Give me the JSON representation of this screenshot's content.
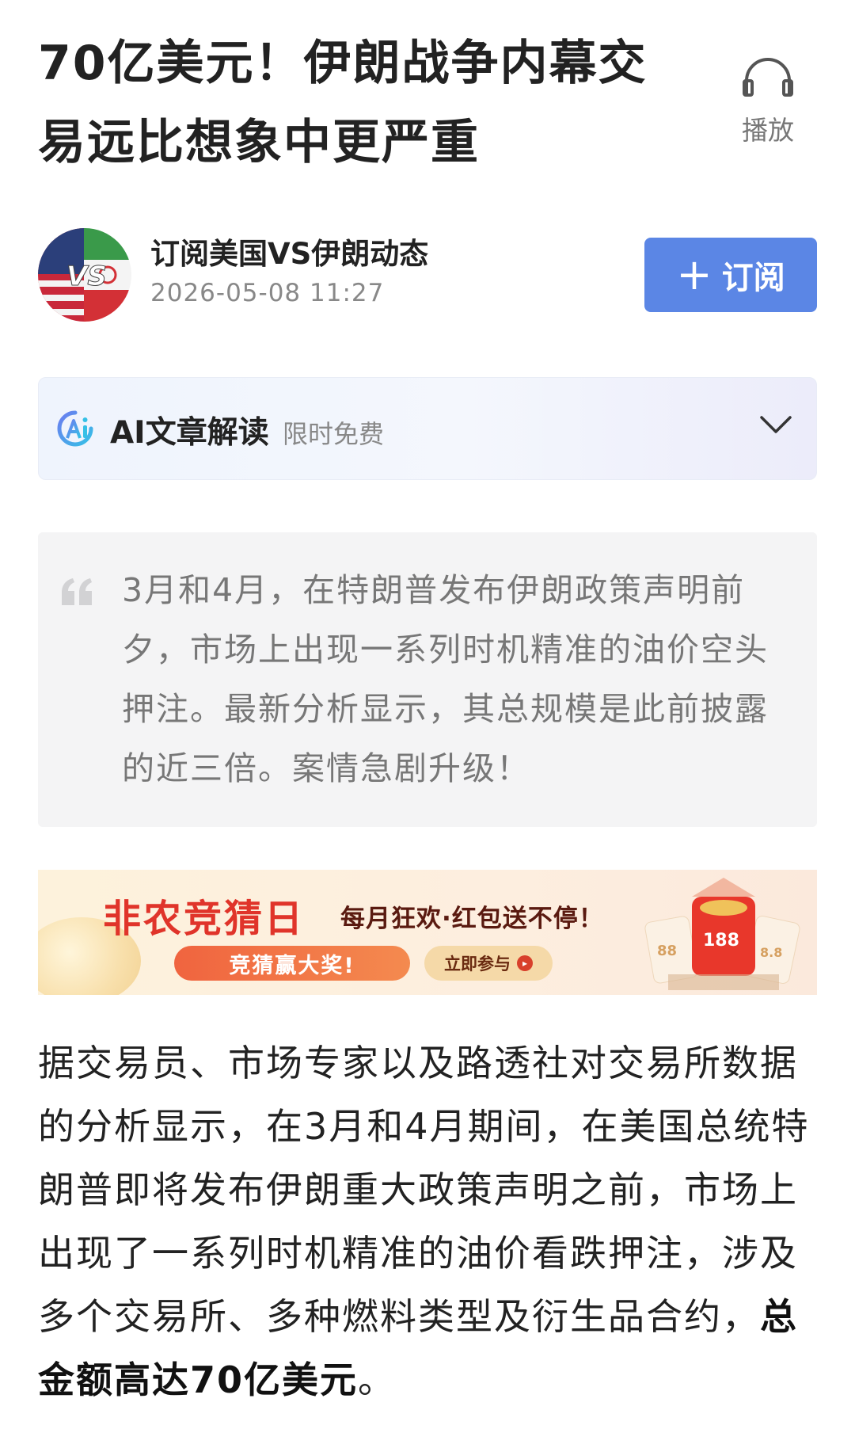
{
  "article": {
    "title": "70亿美元！伊朗战争内幕交易远比想象中更严重",
    "listen_label": "播放"
  },
  "author": {
    "name": "订阅美国VS伊朗动态",
    "time": "2026-05-08 11:27",
    "avatar_text": "VS",
    "subscribe_label": "订阅",
    "subscribe_icon": "plus-icon"
  },
  "ai_reader": {
    "title": "AI文章解读",
    "badge": "限时免费",
    "icon": "ai-logo-icon",
    "expand_icon": "chevron-down-icon"
  },
  "summary": {
    "text": "3月和4月，在特朗普发布伊朗政策声明前夕，市场上出现一系列时机精准的油价空头押注。最新分析显示，其总规模是此前披露的近三倍。案情急剧升级！"
  },
  "banner": {
    "title": "非农竞猜日",
    "subtitle": "每月狂欢·红包送不停！",
    "button_primary": "竞猜赢大奖!",
    "button_secondary": "立即参与",
    "envelope_left": "88",
    "envelope_center": "188",
    "envelope_right": "8.8"
  },
  "body": {
    "paragraph_plain": "据交易员、市场专家以及路透社对交易所数据的分析显示，在3月和4月期间，在美国总统特朗普即将发布伊朗重大政策声明之前，市场上出现了一系列时机精准的油价看跌押注，涉及多个交易所、多种燃料类型及衍生品合约，",
    "paragraph_bold": "总金额高达70亿美元",
    "paragraph_end": "。"
  },
  "colors": {
    "accent": "#5b86e5",
    "banner_red": "#e0342a",
    "quote_bg": "#f4f4f5"
  }
}
